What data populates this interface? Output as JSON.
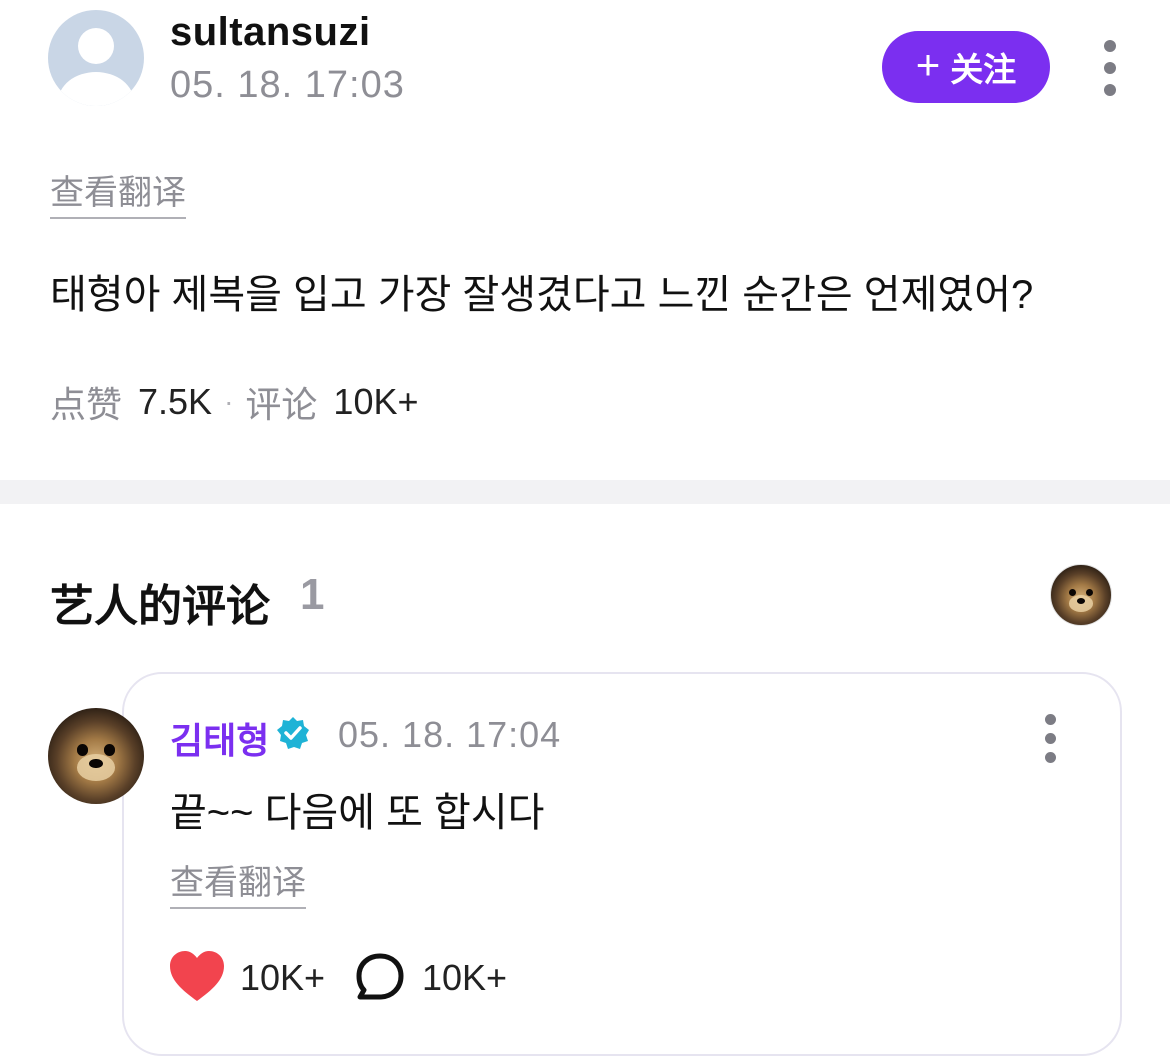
{
  "post": {
    "username": "sultansuzi",
    "timestamp": "05. 18. 17:03",
    "follow_label": "关注",
    "follow_icon": "+",
    "translate_label": "查看翻译",
    "text": "태형아 제복을 입고 가장 잘생겼다고 느낀 순간은 언제였어?",
    "stats": {
      "likes_label": "点赞",
      "likes_value": "7.5K",
      "separator": "·",
      "comments_label": "评论",
      "comments_value": "10K+"
    }
  },
  "artist_comments": {
    "title": "艺人的评论",
    "count": "1"
  },
  "comment": {
    "author": "김태형",
    "timestamp": "05. 18. 17:04",
    "text": "끝~~ 다음에 또 합시다",
    "translate_label": "查看翻译",
    "likes": "10K+",
    "replies": "10K+"
  },
  "colors": {
    "accent": "#7b2ff0",
    "heart": "#f2444e",
    "verified": "#1fb3d6",
    "muted": "#8e8e95"
  }
}
